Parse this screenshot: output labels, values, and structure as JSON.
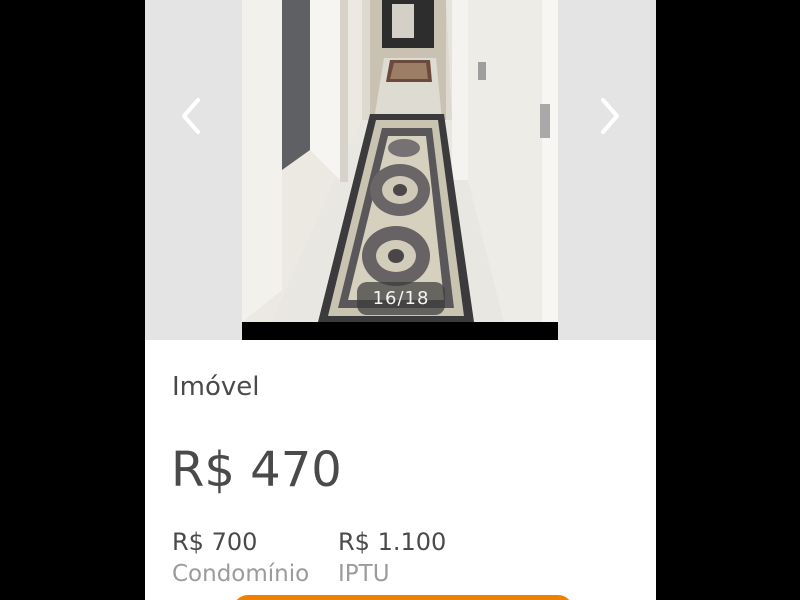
{
  "gallery": {
    "counter": "16/18",
    "prev_icon": "chevron-left-icon",
    "next_icon": "chevron-right-icon"
  },
  "listing": {
    "category": "Imóvel",
    "price": "R$ 470",
    "fees": [
      {
        "value": "R$ 700",
        "label": "Condomínio"
      },
      {
        "value": "R$ 1.100",
        "label": "IPTU"
      }
    ]
  },
  "colors": {
    "accent": "#f28000",
    "text_primary": "#4a4a4a",
    "text_secondary": "#9b9b9b",
    "gallery_bg": "#e4e4e4"
  }
}
